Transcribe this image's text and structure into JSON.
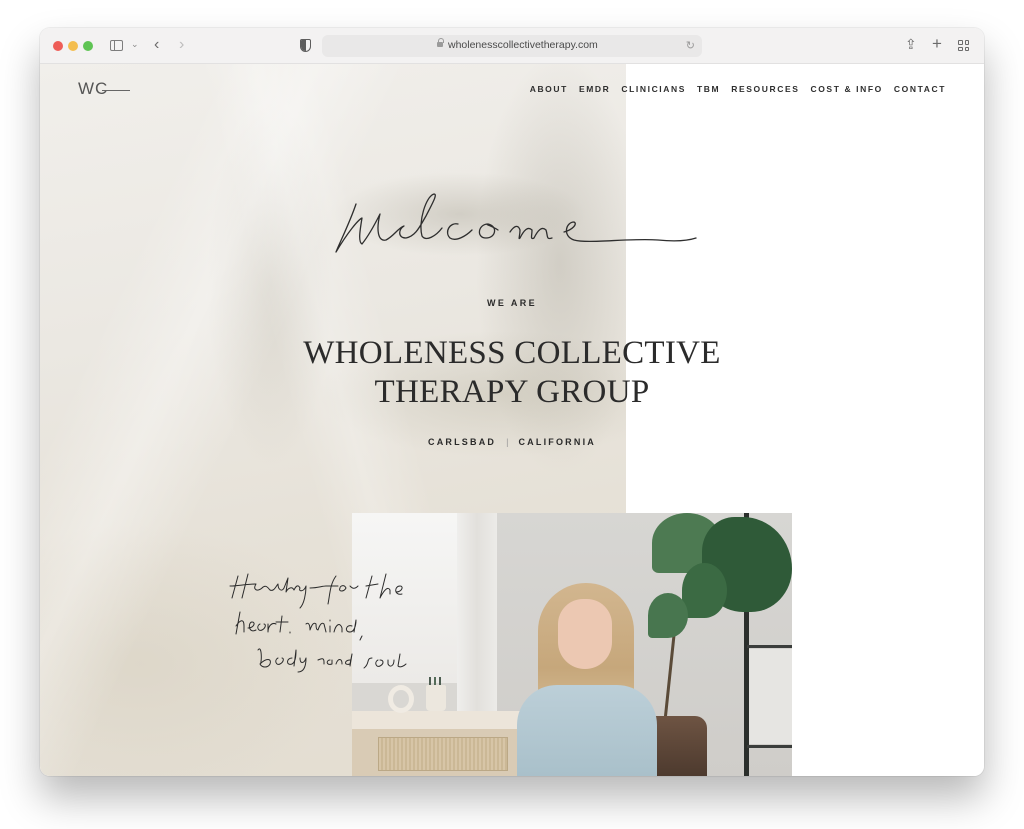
{
  "browser": {
    "url": "wholenesscollectivetherapy.com",
    "icons": {
      "close": "traffic-close",
      "minimize": "traffic-minimize",
      "zoom": "traffic-zoom",
      "sidebar": "sidebar-icon",
      "sidebar_menu": "chevron-down-icon",
      "back": "chevron-left-icon",
      "forward": "chevron-right-icon",
      "privacy": "shield-icon",
      "lock": "lock-icon",
      "reload": "reload-icon",
      "share": "share-icon",
      "new_tab": "plus-icon",
      "tab_overview": "grid-icon"
    },
    "glyphs": {
      "sidebar_menu": "⌄",
      "back": "‹",
      "forward": "›",
      "reload": "↻",
      "share": "⇪",
      "new_tab": "+"
    }
  },
  "site": {
    "logo": "WC",
    "nav": [
      "ABOUT",
      "EMDR",
      "CLINICIANS",
      "TBM",
      "RESOURCES",
      "COST & INFO",
      "CONTACT"
    ],
    "hero": {
      "script_heading": "Welcome",
      "eyebrow": "WE ARE",
      "title_line1": "WHOLENESS COLLECTIVE",
      "title_line2": "THERAPY GROUP",
      "city": "CARLSBAD",
      "separator": "|",
      "state": "CALIFORNIA"
    },
    "tagline": {
      "line1": "Healing for the",
      "line2": "heart, mind,",
      "line3": "body and soul"
    },
    "photo_alt": "Therapist smiling seated in an office beside a fiddle leaf fig plant"
  }
}
